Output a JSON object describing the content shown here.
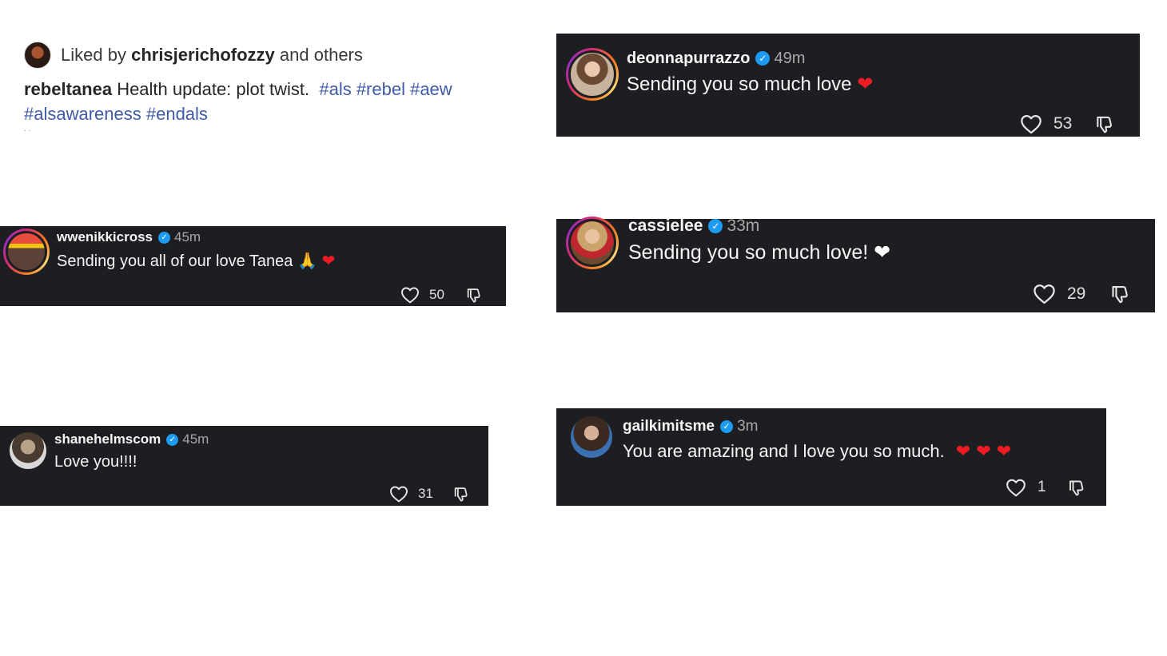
{
  "post": {
    "liked_prefix": "Liked by",
    "liked_user": "chrisjerichofozzy",
    "liked_suffix": "and others",
    "author": "rebeltanea",
    "caption_text": "Health update: plot twist.",
    "hashtags_line1": "#als #rebel #aew",
    "hashtags_line2": "#alsawareness #endals",
    "more_dots": ". ."
  },
  "comments": [
    {
      "username": "deonnapurrazzo",
      "time": "49m",
      "text": "Sending you so much love",
      "emoji": "❤",
      "likes": "53"
    },
    {
      "username": "wwenikkicross",
      "time": "45m",
      "text": "Sending you all of our love Tanea",
      "emoji_pray": "🙏",
      "emoji": "❤",
      "likes": "50"
    },
    {
      "username": "cassielee",
      "time": "33m",
      "text": "Sending you so much love!",
      "emoji": "❤",
      "likes": "29"
    },
    {
      "username": "shanehelmscom",
      "time": "45m",
      "text": "Love you!!!!",
      "likes": "31"
    },
    {
      "username": "gailkimitsme",
      "time": "3m",
      "text": "You are amazing and I love you so much.",
      "emoji": "❤ ❤ ❤",
      "likes": "1"
    }
  ],
  "colors": {
    "card_bg": "#1c1e21",
    "hashtag": "#3f5aa8",
    "verified": "#1d9bf0",
    "heart_red": "#ed1c24"
  },
  "icons": {
    "like": "heart-outline-icon",
    "dislike": "thumbs-down-outline-icon",
    "verified": "verified-badge-icon"
  }
}
